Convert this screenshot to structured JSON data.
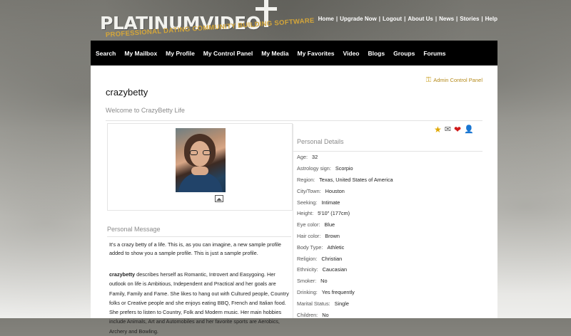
{
  "brand": {
    "name": "PLATINUMVIDEO",
    "tagline": "PROFESSIONAL DATING COMMUNITY BUILDING SOFTWARE"
  },
  "top_links": [
    "Home",
    "Upgrade Now",
    "Logout",
    "About Us",
    "News",
    "Stories",
    "Help"
  ],
  "nav": [
    "Search",
    "My Mailbox",
    "My Profile",
    "My Control Panel",
    "My Media",
    "My Favorites",
    "Video",
    "Blogs",
    "Groups",
    "Forums"
  ],
  "admin_link": "Admin Control Panel",
  "profile": {
    "username": "crazybetty",
    "welcome": "Welcome to CrazyBetty Life",
    "personal_message_heading": "Personal Message",
    "personal_message": "It's a crazy betty of a life. This is, as you can imagine, a new sample profile added to show you a sample profile. This is just a sample profile.",
    "about_name": "crazybetty",
    "about_text": " describes herself as Romantic, Introvert and Easygoing. Her outlook on life is Ambitious, Independent and Practical and her goals are Family, Family and Fame. She likes to hang out with Cultured people, Country folks or Creative people and she enjoys eating BBQ, French and Italian food. She prefers to listen to Country, Folk and Modern music. Her main hobbies include Animals, Art and Automobiles and her favorite sports are Aerobics, Archery and Bowling.",
    "details_heading": "Personal Details",
    "details": [
      {
        "k": "Age:",
        "v": "32"
      },
      {
        "k": "Astrology sign:",
        "v": "Scorpio"
      },
      {
        "k": "Region:",
        "v": "Texas, United States of America"
      },
      {
        "k": "City/Town:",
        "v": "Houston"
      },
      {
        "k": "Seeking:",
        "v": "Intimate"
      },
      {
        "k": "Height:",
        "v": "5'10\" (177cm)"
      },
      {
        "k": "Eye color:",
        "v": "Blue"
      },
      {
        "k": "Hair color:",
        "v": "Brown"
      },
      {
        "k": "Body Type:",
        "v": "Athletic"
      },
      {
        "k": "Religion:",
        "v": "Christian"
      },
      {
        "k": "Ethnicity:",
        "v": "Caucasian"
      },
      {
        "k": "Smoker:",
        "v": "No"
      },
      {
        "k": "Drinking:",
        "v": "Yes frequently"
      },
      {
        "k": "Marital Status:",
        "v": "Single"
      },
      {
        "k": "Children:",
        "v": "No"
      }
    ]
  },
  "action_icons": [
    "star-icon",
    "mail-icon",
    "heart-icon",
    "user-icon"
  ],
  "colors": {
    "nav_bg": "#000000",
    "admin_link": "#b58a1a",
    "heading_gray": "#8a8a8a"
  }
}
